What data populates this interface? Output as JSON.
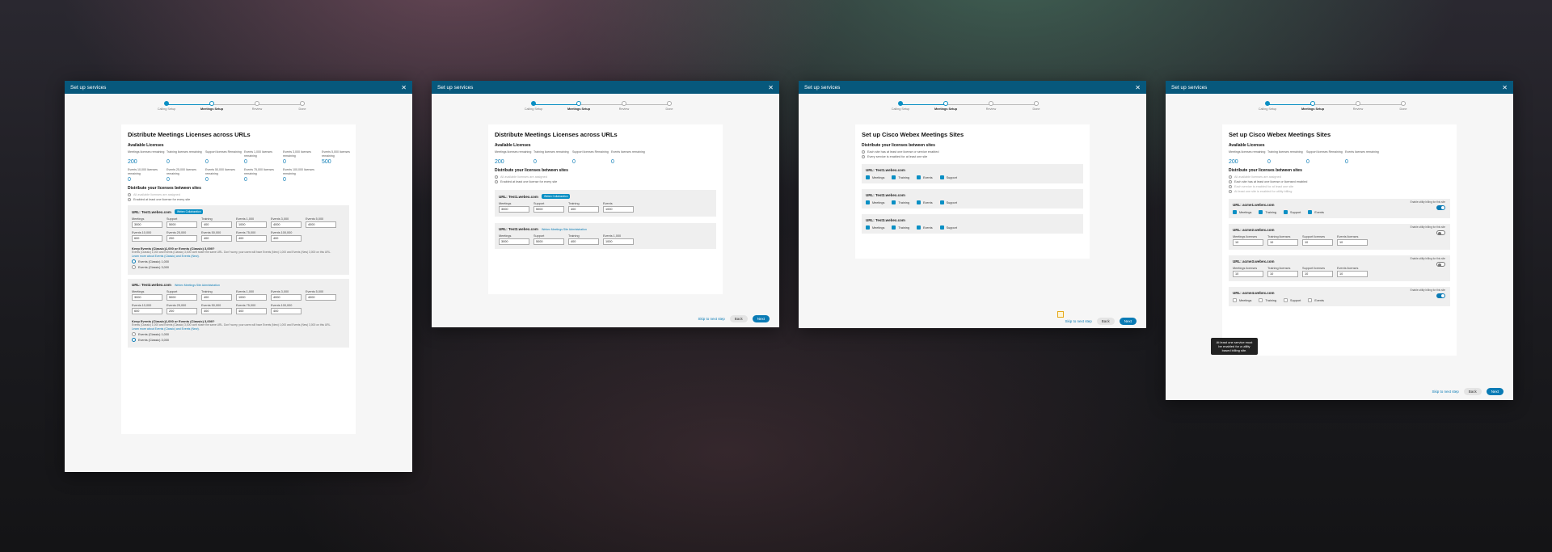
{
  "header_title": "Set up services",
  "steps": [
    "Calling Setup",
    "Meetings Setup",
    "Review",
    "Done"
  ],
  "skip": "Skip to next step",
  "back": "Back",
  "next": "Next",
  "win1": {
    "title": "Distribute Meetings Licenses across URLs",
    "available": "Available Licenses",
    "licenses": [
      {
        "label": "Meetings licenses remaining",
        "value": "200"
      },
      {
        "label": "Training licenses remaining",
        "value": "0"
      },
      {
        "label": "Support licenses Remaining",
        "value": "0"
      },
      {
        "label": "Events 1,000 licenses remaining",
        "value": "0"
      },
      {
        "label": "Events 3,000 licenses remaining",
        "value": "0"
      },
      {
        "label": "Events 5,000 licenses remaining",
        "value": "500"
      },
      {
        "label": "Events 10,000 licenses remaining",
        "value": "0"
      },
      {
        "label": "Events 25,000 licenses remaining",
        "value": "0"
      },
      {
        "label": "Events 50,000 licenses remaining",
        "value": "0"
      },
      {
        "label": "Events 75,000 licenses remaining",
        "value": "0"
      },
      {
        "label": "Events 100,000 licenses remaining",
        "value": "0"
      }
    ],
    "distribute": "Distribute your licenses between sites",
    "rule1": "All available licenses are assigned",
    "rule2": "Enabled at least one license for every site",
    "urls": [
      {
        "url": "URL: Test1.webex.com",
        "tag": "Webex Collaboration",
        "fields": [
          [
            "Meetings",
            "3000"
          ],
          [
            "Support",
            "5000"
          ],
          [
            "Training",
            "400"
          ],
          [
            "Events 1,000",
            "1000"
          ],
          [
            "Events 3,000",
            "4000"
          ],
          [
            "Events 5,000",
            "4000"
          ],
          [
            "Events 10,000",
            "600"
          ],
          [
            "Events 25,000",
            "200"
          ],
          [
            "Events 50,000",
            "400"
          ],
          [
            "Events 75,000",
            "400"
          ],
          [
            "Events 100,000",
            "400"
          ]
        ],
        "keep": "Keep Events (Classic)1,000 or Events (Classic) 3,000?",
        "note": "Events (Classic) 1,000 and Events (Classic) 3,000 can't share the same URL. Don't worry, your users will have Events (New) 1,000 and Events (New) 3,000 on this URL.",
        "learn": "Learn more about Events (Classic) and Events (New).",
        "opt1": "Events (Classic) 1,000",
        "opt2": "Events (Classic) 3,000"
      },
      {
        "url": "URL: Test2.webex.com",
        "tag": "Webex Meetings Site Administration",
        "fields": [
          [
            "Meetings",
            "3000"
          ],
          [
            "Support",
            "5000"
          ],
          [
            "Training",
            "400"
          ],
          [
            "Events 1,000",
            "1000"
          ],
          [
            "Events 3,000",
            "4000"
          ],
          [
            "Events 5,000",
            "4000"
          ],
          [
            "Events 10,000",
            "600"
          ],
          [
            "Events 25,000",
            "200"
          ],
          [
            "Events 50,000",
            "400"
          ],
          [
            "Events 75,000",
            "400"
          ],
          [
            "Events 100,000",
            "400"
          ]
        ],
        "keep": "Keep Events (Classic)1,000 or Events (Classic) 3,000?",
        "note": "Events (Classic) 1,000 and Events (Classic) 3,000 can't share the same URL. Don't worry, your users will have Events (New) 1,000 and Events (New) 3,000 on this URL.",
        "learn": "Learn more about Events (Classic) and Events (New).",
        "opt1": "Events (Classic) 1,000",
        "opt2": "Events (Classic) 3,000"
      }
    ]
  },
  "win2": {
    "title": "Distribute Meetings Licenses across URLs",
    "available": "Available Licenses",
    "licenses": [
      {
        "label": "Meetings licenses remaining",
        "value": "200"
      },
      {
        "label": "Training licenses remaining",
        "value": "0"
      },
      {
        "label": "Support licenses Remaining",
        "value": "0"
      },
      {
        "label": "Events licenses remaining",
        "value": "0"
      }
    ],
    "distribute": "Distribute your licenses between sites",
    "rule1": "All available licenses are assigned",
    "rule2": "Enabled at least one license for every site",
    "urls": [
      {
        "url": "URL: Test1.webex.com",
        "tag": "Webex Collaboration",
        "fields": [
          [
            "Meetings",
            "3000"
          ],
          [
            "Support",
            "5000"
          ],
          [
            "Training",
            "400"
          ],
          [
            "Events",
            "1000"
          ]
        ]
      },
      {
        "url": "URL: Test2.webex.com",
        "tag": "Webex Meetings Site Administration",
        "fields": [
          [
            "Meetings",
            "3000"
          ],
          [
            "Support",
            "5000"
          ],
          [
            "Training",
            "400"
          ],
          [
            "Events 1,000",
            "1000"
          ]
        ]
      }
    ]
  },
  "win3": {
    "title": "Set up Cisco Webex Meetings Sites",
    "distribute": "Distribute your licenses between sites",
    "rule1": "Each site has at least one license or service enabled",
    "rule2": "Every service is enabled for at least one site",
    "urls": [
      {
        "url": "URL: Test1.webex.com",
        "items": [
          "Meetings",
          "Training",
          "Events",
          "Support"
        ]
      },
      {
        "url": "URL: Test2.webex.com",
        "items": [
          "Meetings",
          "Training",
          "Events",
          "Support"
        ]
      },
      {
        "url": "URL: Test3.webex.com",
        "items": [
          "Meetings",
          "Training",
          "Events",
          "Support"
        ]
      }
    ]
  },
  "win4": {
    "title": "Set up Cisco Webex Meetings Sites",
    "available": "Available Licenses",
    "licenses": [
      {
        "label": "Meetings licenses remaining",
        "value": "200"
      },
      {
        "label": "Training licenses remaining",
        "value": "0"
      },
      {
        "label": "Support licenses Remaining",
        "value": "0"
      },
      {
        "label": "Events licenses remaining",
        "value": "0"
      }
    ],
    "distribute": "Distribute your licenses between sites",
    "rules": [
      "All available licenses are assigned",
      "Each site has at least one license or licensed enabled",
      "Each service is enabled for at least one site",
      "At least one site is enabled for utility billing"
    ],
    "enable_billing": "Enable utility billing for this site",
    "urls": [
      {
        "url": "URL: acme1.webex.com",
        "type": "checks",
        "items": [
          "Meetings",
          "Training",
          "Support",
          "Events"
        ],
        "on": true
      },
      {
        "url": "URL: acme2.webex.com",
        "type": "fields",
        "fields": [
          [
            "Meetings licenses",
            "10"
          ],
          [
            "Training licenses",
            "10"
          ],
          [
            "Support licenses",
            "10"
          ],
          [
            "Events licenses",
            "10"
          ]
        ],
        "on": false
      },
      {
        "url": "URL: acme3.webex.com",
        "type": "fields",
        "fields": [
          [
            "Meetings licenses",
            "10"
          ],
          [
            "Training licenses",
            "10"
          ],
          [
            "Support licenses",
            "10"
          ],
          [
            "Events licenses",
            "10"
          ]
        ],
        "on": false
      },
      {
        "url": "URL: acme4.webex.com",
        "type": "checks",
        "items": [
          "Meetings",
          "Training",
          "Support",
          "Events"
        ],
        "on": true,
        "unchecked": true
      }
    ],
    "tooltip": "At least one service must be enabled for a utility based billing site."
  }
}
